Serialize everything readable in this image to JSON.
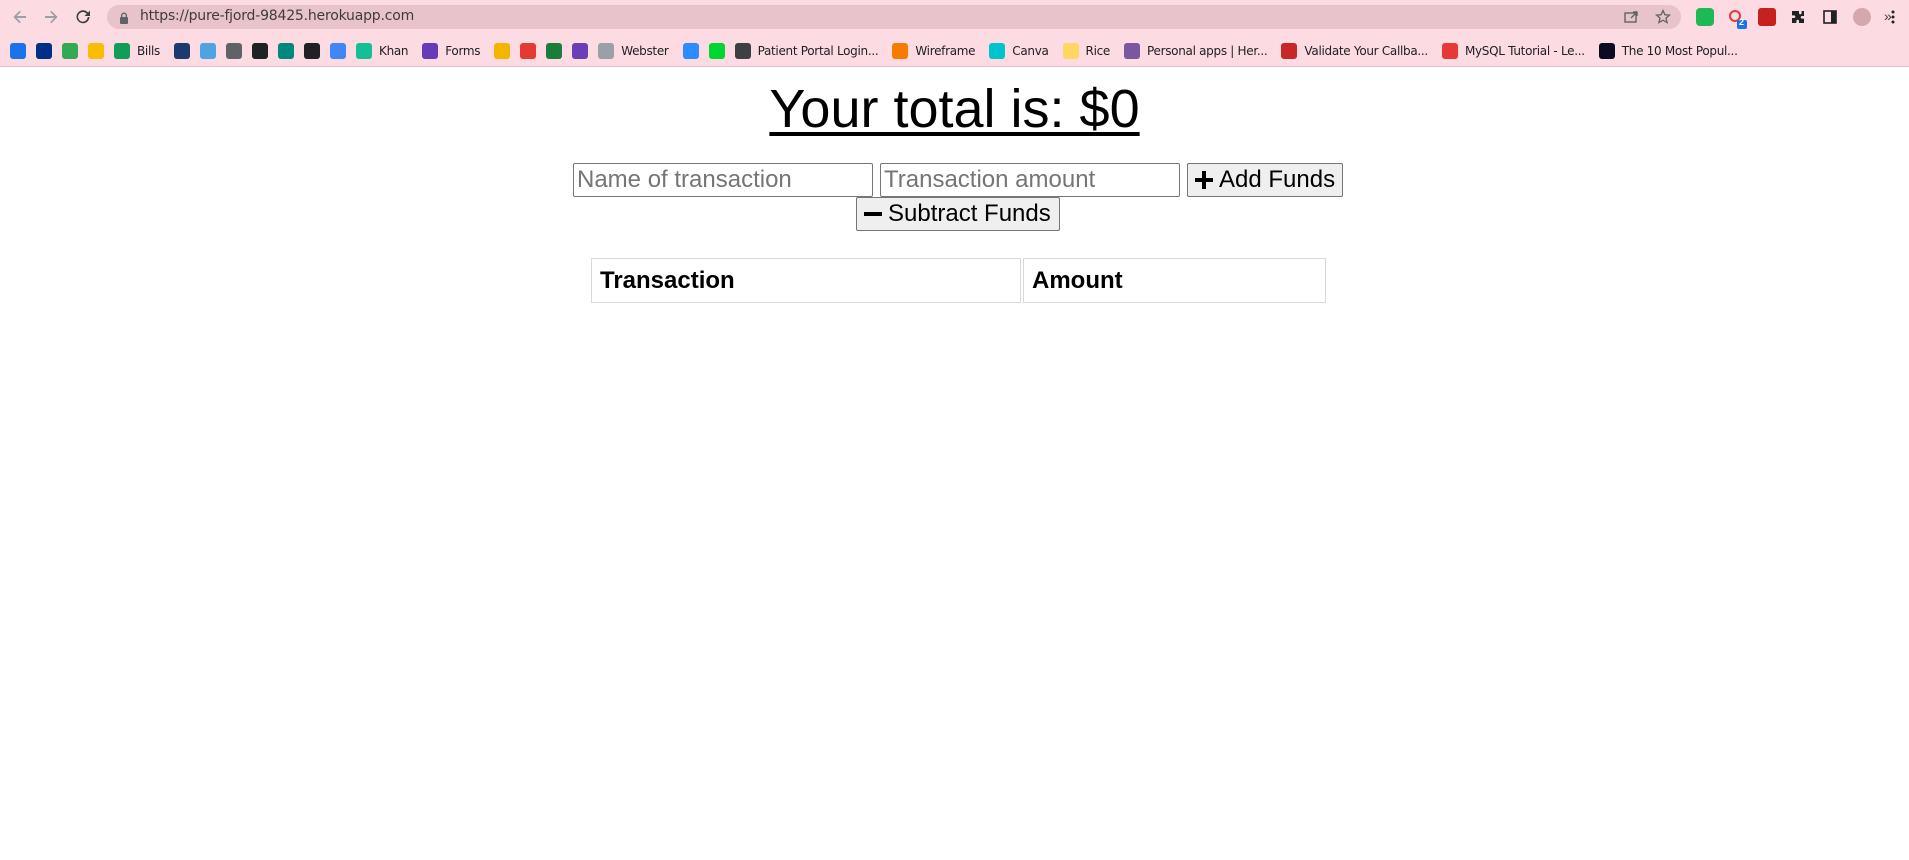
{
  "browser": {
    "url": "https://pure-fjord-98425.herokuapp.com",
    "extension_badge": "2",
    "bookmarks": [
      {
        "label": "",
        "icon": "car-icon",
        "color": "#1a73e8"
      },
      {
        "label": "",
        "icon": "paypal-icon",
        "color": "#003087"
      },
      {
        "label": "",
        "icon": "maps-icon",
        "color": "#34a853"
      },
      {
        "label": "",
        "icon": "drive-icon",
        "color": "#fbbc04"
      },
      {
        "label": "Bills",
        "icon": "sheets-icon",
        "color": "#0f9d58"
      },
      {
        "label": "",
        "icon": "tac-icon",
        "color": "#1b3b70"
      },
      {
        "label": "",
        "icon": "cloud-icon",
        "color": "#4fa3e0"
      },
      {
        "label": "",
        "icon": "sync-icon",
        "color": "#5f6368"
      },
      {
        "label": "",
        "icon": "s-icon",
        "color": "#202124"
      },
      {
        "label": "",
        "icon": "meet-icon",
        "color": "#00897b"
      },
      {
        "label": "",
        "icon": "globe-icon",
        "color": "#202124"
      },
      {
        "label": "",
        "icon": "calendar-icon",
        "color": "#4285f4"
      },
      {
        "label": "Khan",
        "icon": "khan-icon",
        "color": "#14bf96"
      },
      {
        "label": "Forms",
        "icon": "forms-icon",
        "color": "#673ab7"
      },
      {
        "label": "",
        "icon": "classroom-icon",
        "color": "#f4b400"
      },
      {
        "label": "",
        "icon": "red-circle-icon",
        "color": "#e53935"
      },
      {
        "label": "",
        "icon": "w-icon",
        "color": "#1b7c3c"
      },
      {
        "label": "",
        "icon": "shield-icon",
        "color": "#6a3fb5"
      },
      {
        "label": "Webster",
        "icon": "webster-icon",
        "color": "#9aa0a6"
      },
      {
        "label": "",
        "icon": "zoom-icon",
        "color": "#2d8cff"
      },
      {
        "label": "",
        "icon": "dollar-icon",
        "color": "#00d632"
      },
      {
        "label": "Patient Portal Login...",
        "icon": "portal-icon",
        "color": "#3c4043"
      },
      {
        "label": "Wireframe",
        "icon": "wireframe-icon",
        "color": "#f57c00"
      },
      {
        "label": "Canva",
        "icon": "canva-icon",
        "color": "#00c4cc"
      },
      {
        "label": "Rice",
        "icon": "folder-icon",
        "color": "#fdd663"
      },
      {
        "label": "Personal apps | Her...",
        "icon": "heroku-icon",
        "color": "#79589f"
      },
      {
        "label": "Validate Your Callba...",
        "icon": "guitar-icon",
        "color": "#c62828"
      },
      {
        "label": "MySQL Tutorial - Le...",
        "icon": "mysql-icon",
        "color": "#e53935"
      },
      {
        "label": "The 10 Most Popul...",
        "icon": "dev-icon",
        "color": "#0a0a23"
      }
    ]
  },
  "app": {
    "total_label": "Your total is: $0",
    "name_placeholder": "Name of transaction",
    "amount_placeholder": "Transaction amount",
    "add_button": "Add Funds",
    "subtract_button": "Subtract Funds",
    "table": {
      "headers": [
        "Transaction",
        "Amount"
      ]
    }
  }
}
